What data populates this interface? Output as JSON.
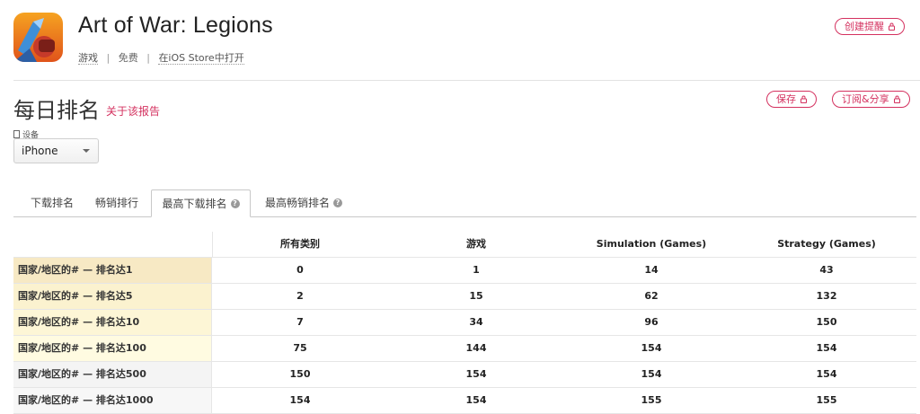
{
  "app": {
    "title": "Art of War: Legions",
    "category": "游戏",
    "price": "免费",
    "store_link": "在iOS Store中打开"
  },
  "actions": {
    "create_alert": "创建提醒",
    "save": "保存",
    "subscribe_share": "订阅&分享"
  },
  "section": {
    "title": "每日排名",
    "about": "关于该报告"
  },
  "device": {
    "label": "设备",
    "selected": "iPhone"
  },
  "tabs": [
    {
      "label": "下载排名",
      "active": false,
      "help": false
    },
    {
      "label": "畅销排行",
      "active": false,
      "help": false
    },
    {
      "label": "最高下载排名",
      "active": true,
      "help": true
    },
    {
      "label": "最高畅销排名",
      "active": false,
      "help": true
    }
  ],
  "table": {
    "columns": [
      "所有类别",
      "游戏",
      "Simulation (Games)",
      "Strategy (Games)"
    ],
    "rows": [
      {
        "label": "国家/地区的# — 排名达1",
        "values": [
          "0",
          "1",
          "14",
          "43"
        ],
        "color": "#f7e9c4"
      },
      {
        "label": "国家/地区的# — 排名达5",
        "values": [
          "2",
          "15",
          "62",
          "132"
        ],
        "color": "#fbf2cf"
      },
      {
        "label": "国家/地区的# — 排名达10",
        "values": [
          "7",
          "34",
          "96",
          "150"
        ],
        "color": "#fdf6d6"
      },
      {
        "label": "国家/地区的# — 排名达100",
        "values": [
          "75",
          "144",
          "154",
          "154"
        ],
        "color": "#fffbe1"
      },
      {
        "label": "国家/地区的# — 排名达500",
        "values": [
          "150",
          "154",
          "154",
          "154"
        ],
        "color": "#f4f4f4"
      },
      {
        "label": "国家/地区的# — 排名达1000",
        "values": [
          "154",
          "154",
          "155",
          "155"
        ],
        "color": "#f7f7f7"
      }
    ]
  },
  "colors": {
    "accent": "#d4315f"
  }
}
